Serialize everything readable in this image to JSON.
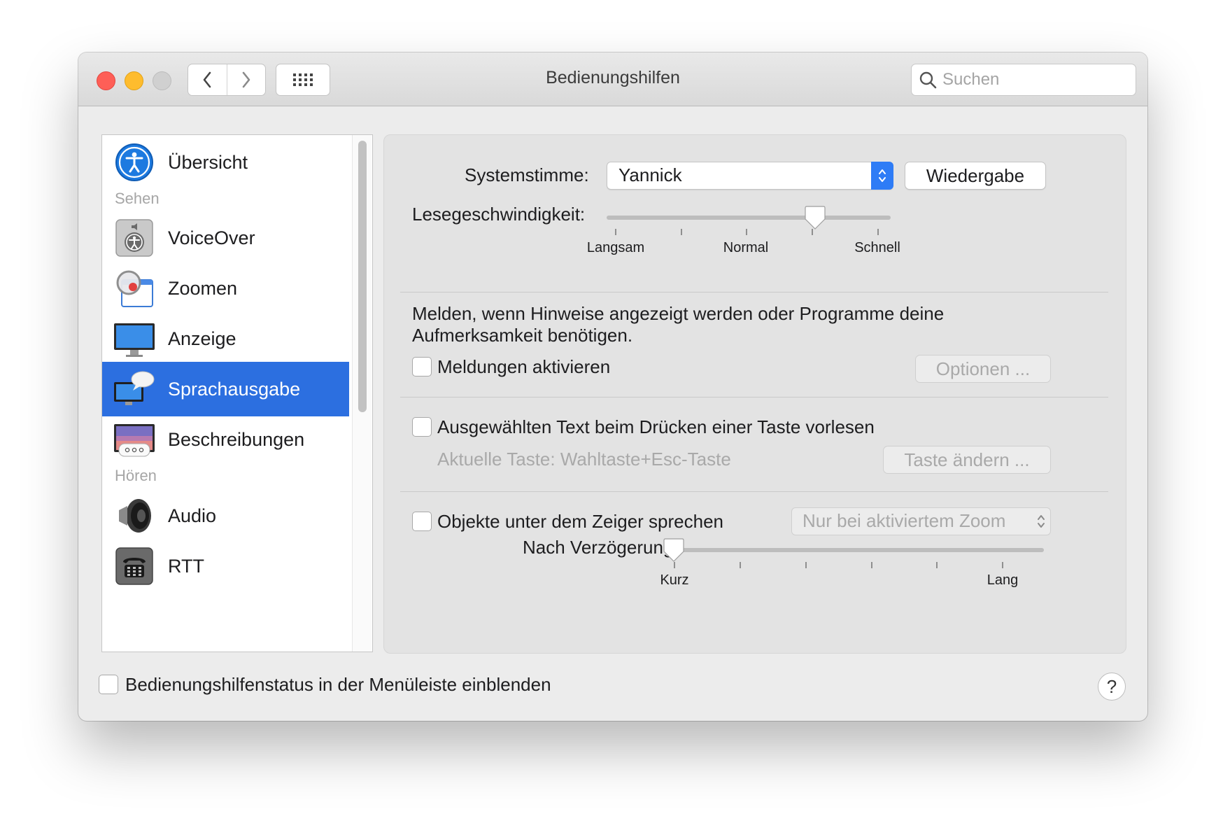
{
  "window": {
    "title": "Bedienungshilfen"
  },
  "toolbar": {
    "back_icon": "chevron-left-icon",
    "forward_icon": "chevron-right-icon",
    "grid_icon": "grid-icon",
    "search_placeholder": "Suchen"
  },
  "sidebar": {
    "items": [
      {
        "label": "Übersicht",
        "icon": "accessibility-icon"
      },
      {
        "label": "VoiceOver",
        "icon": "voiceover-icon"
      },
      {
        "label": "Zoomen",
        "icon": "zoom-icon"
      },
      {
        "label": "Anzeige",
        "icon": "display-icon"
      },
      {
        "label": "Sprachausgabe",
        "icon": "speech-icon",
        "selected": true
      },
      {
        "label": "Beschreibungen",
        "icon": "descriptions-icon"
      },
      {
        "label": "Audio",
        "icon": "speaker-icon"
      },
      {
        "label": "RTT",
        "icon": "telephone-icon"
      }
    ],
    "sections": {
      "sehen": "Sehen",
      "hoeren": "Hören"
    }
  },
  "speech": {
    "voice_label": "Systemstimme:",
    "voice_value": "Yannick",
    "play_button": "Wiedergabe",
    "rate_label": "Lesegeschwindigkeit:",
    "rate_ticks": [
      "Langsam",
      "Normal",
      "Schnell"
    ],
    "rate_value": 0.76,
    "announce_text_1": "Melden, wenn Hinweise angezeigt werden oder Programme deine",
    "announce_text_2": "Aufmerksamkeit benötigen.",
    "announce_checkbox": "Meldungen aktivieren",
    "announce_checked": false,
    "options_button": "Optionen ...",
    "speak_selected_checkbox": "Ausgewählten Text beim Drücken einer Taste vorlesen",
    "speak_selected_checked": false,
    "current_key": "Aktuelle Taste: Wahltaste+Esc-Taste",
    "change_key_button": "Taste ändern ...",
    "pointer_checkbox": "Objekte unter dem Zeiger sprechen",
    "pointer_checked": false,
    "pointer_mode": "Nur bei aktiviertem Zoom",
    "delay_label": "Nach Verzögerung:",
    "delay_ticks": [
      "Kurz",
      "Lang"
    ],
    "delay_value": 0.0
  },
  "footer": {
    "menubar_checkbox": "Bedienungshilfenstatus in der Menüleiste einblenden",
    "menubar_checked": false,
    "help_label": "?"
  },
  "colors": {
    "selection": "#2c6fe0",
    "close": "#fe5f57",
    "minimize": "#febc2e"
  }
}
